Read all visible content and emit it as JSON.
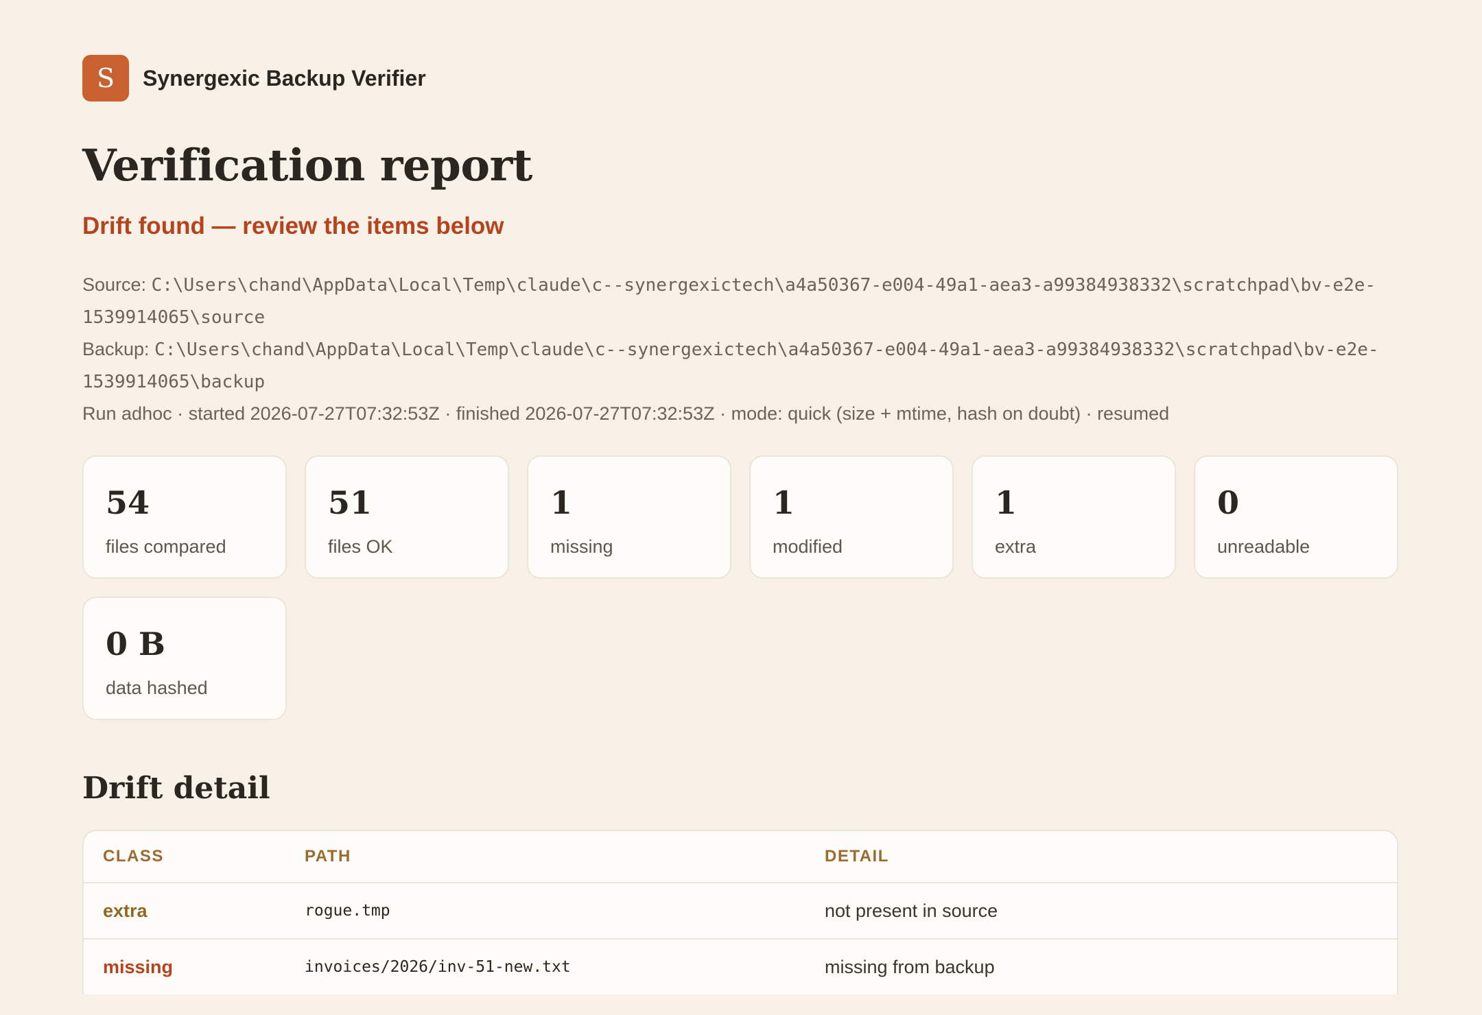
{
  "app": {
    "name": "Synergexic Backup Verifier",
    "logo_letter": "S"
  },
  "report": {
    "title": "Verification report",
    "status": "Drift found — review the items below",
    "source_label": "Source: ",
    "source_path": "C:\\Users\\chand\\AppData\\Local\\Temp\\claude\\c--synergexictech\\a4a50367-e004-49a1-aea3-a99384938332\\scratchpad\\bv-e2e-1539914065\\source",
    "backup_label": "Backup: ",
    "backup_path": "C:\\Users\\chand\\AppData\\Local\\Temp\\claude\\c--synergexictech\\a4a50367-e004-49a1-aea3-a99384938332\\scratchpad\\bv-e2e-1539914065\\backup",
    "run_info": "Run adhoc · started 2026-07-27T07:32:53Z · finished 2026-07-27T07:32:53Z · mode: quick (size + mtime, hash on doubt) · resumed"
  },
  "stats": [
    {
      "value": "54",
      "label": "files compared"
    },
    {
      "value": "51",
      "label": "files OK"
    },
    {
      "value": "1",
      "label": "missing"
    },
    {
      "value": "1",
      "label": "modified"
    },
    {
      "value": "1",
      "label": "extra"
    },
    {
      "value": "0",
      "label": "unreadable"
    },
    {
      "value": "0 B",
      "label": "data hashed"
    }
  ],
  "drift": {
    "title": "Drift detail",
    "columns": [
      "CLASS",
      "PATH",
      "DETAIL"
    ],
    "rows": [
      {
        "class": "extra",
        "path": "rogue.tmp",
        "detail": "not present in source"
      },
      {
        "class": "missing",
        "path": "invoices/2026/inv-51-new.txt",
        "detail": "missing from backup"
      }
    ]
  },
  "colors": {
    "accent": "#c9602f",
    "status_drift": "#b5441e",
    "extra": "#8e6a25",
    "background": "#f7f1e8"
  }
}
